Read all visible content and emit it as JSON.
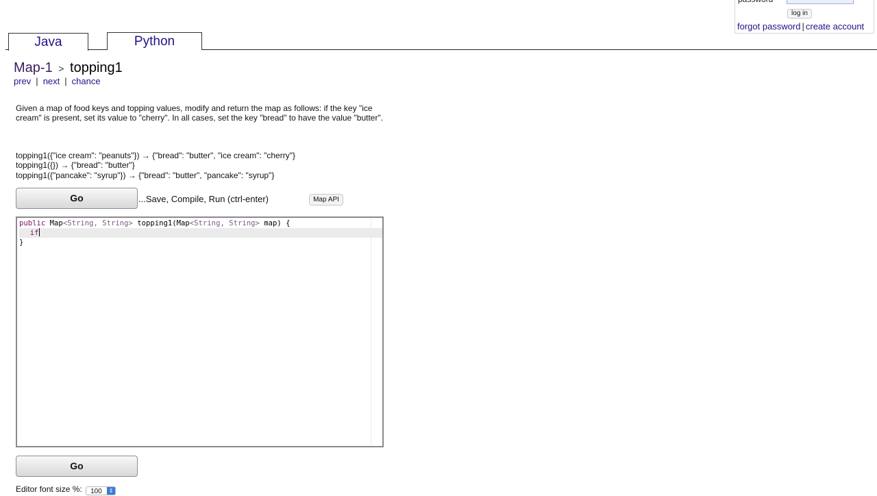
{
  "login": {
    "password_label": "password",
    "password_value": "••••••••",
    "login_button": "log in",
    "forgot_password": "forgot password",
    "separator": "|",
    "create_account": "create account"
  },
  "tabs": [
    {
      "label": "Java"
    },
    {
      "label": "Python"
    }
  ],
  "breadcrumb": {
    "section": "Map-1",
    "arrow": ">",
    "problem": "topping1"
  },
  "nav": {
    "prev": "prev",
    "next": "next",
    "chance": "chance",
    "separator": "|"
  },
  "description": "Given a map of food keys and topping values, modify and return the map as follows: if the key \"ice cream\" is present, set its value to \"cherry\". In all cases, set the key \"bread\" to have the value \"butter\".",
  "examples": [
    "topping1({\"ice cream\": \"peanuts\"}) → {\"bread\": \"butter\", \"ice cream\": \"cherry\"}",
    "topping1({}) → {\"bread\": \"butter\"}",
    "topping1({\"pancake\": \"syrup\"}) → {\"bread\": \"butter\", \"pancake\": \"syrup\"}"
  ],
  "actions": {
    "go_label": "Go",
    "go_hint": "...Save, Compile, Run (ctrl-enter)",
    "map_api": "Map API"
  },
  "editor": {
    "line1": {
      "kw": "public",
      "sp1": " ",
      "t1": "Map",
      "g1": "<String, String>",
      "rest1": " topping1(",
      "t2": "Map",
      "g2": "<String, String>",
      "rest2": " map) {"
    },
    "line2": "  if",
    "line3": "}"
  },
  "font_size": {
    "label": "Editor font size %:",
    "value": "100",
    "arrows": "⇕"
  }
}
